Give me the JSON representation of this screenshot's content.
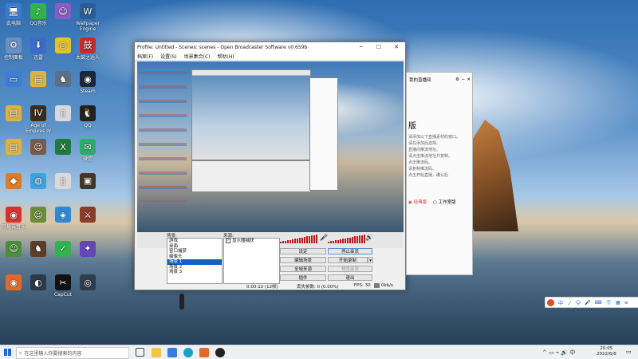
{
  "desktop": {
    "icons": [
      {
        "label": "此电脑",
        "color": "#3a7bd5",
        "glyph": "🖥"
      },
      {
        "label": "QQ音乐",
        "color": "#2fb34a",
        "glyph": "♪"
      },
      {
        "label": "",
        "color": "#8b5cc7",
        "glyph": "☺"
      },
      {
        "label": "Wallpaper Engine",
        "color": "#2a5e9a",
        "glyph": "W"
      },
      {
        "label": "控制面板",
        "color": "#6b8fc2",
        "glyph": "⚙"
      },
      {
        "label": "迅雷",
        "color": "#3a6cc9",
        "glyph": "⬇"
      },
      {
        "label": "",
        "color": "#e4c326",
        "glyph": "◎"
      },
      {
        "label": "太鼓之达人",
        "color": "#c52d2d",
        "glyph": "鼓"
      },
      {
        "label": "",
        "color": "#3b7fd6",
        "glyph": "▭"
      },
      {
        "label": "",
        "color": "#e0b23c",
        "glyph": "▤"
      },
      {
        "label": "",
        "color": "#5d6f86",
        "glyph": "♞"
      },
      {
        "label": "Steam",
        "color": "#1b2838",
        "glyph": "◉"
      },
      {
        "label": "",
        "color": "#e0b23c",
        "glyph": "▤"
      },
      {
        "label": "Age of Empires IV",
        "color": "#3b2b1a",
        "glyph": "IV"
      },
      {
        "label": "",
        "color": "#d9d9d9",
        "glyph": "▯"
      },
      {
        "label": "QQ",
        "color": "#222",
        "glyph": "🐧"
      },
      {
        "label": "",
        "color": "#e0b23c",
        "glyph": "▤"
      },
      {
        "label": "",
        "color": "#7c5a44",
        "glyph": "☺"
      },
      {
        "label": "",
        "color": "#1f7a3e",
        "glyph": "X"
      },
      {
        "label": "微信",
        "color": "#2aae67",
        "glyph": "✉"
      },
      {
        "label": "",
        "color": "#d97d2a",
        "glyph": "◆"
      },
      {
        "label": "",
        "color": "#3ca3e0",
        "glyph": "◍"
      },
      {
        "label": "",
        "color": "#d9d9d9",
        "glyph": "▯"
      },
      {
        "label": "",
        "color": "#44352a",
        "glyph": "▣"
      },
      {
        "label": "网易云音乐",
        "color": "#d8312e",
        "glyph": "◉"
      },
      {
        "label": "",
        "color": "#6c8c3a",
        "glyph": "☺"
      },
      {
        "label": "",
        "color": "#2e88d6",
        "glyph": "◈"
      },
      {
        "label": "",
        "color": "#8e3c2a",
        "glyph": "⚔"
      },
      {
        "label": "",
        "color": "#4a8f3a",
        "glyph": "☺"
      },
      {
        "label": "",
        "color": "#5b3d28",
        "glyph": "♞"
      },
      {
        "label": "",
        "color": "#2fb34a",
        "glyph": "✓"
      },
      {
        "label": "",
        "color": "#6645b5",
        "glyph": "✦"
      },
      {
        "label": "",
        "color": "#e06a2a",
        "glyph": "◉"
      },
      {
        "label": "",
        "color": "#2b3a4a",
        "glyph": "◐"
      },
      {
        "label": "CapCut",
        "color": "#111",
        "glyph": "✂"
      },
      {
        "label": "",
        "color": "#2c3e50",
        "glyph": "◎"
      }
    ]
  },
  "obs": {
    "title": "Profile: Untitled - Scenes: scenes - Open Broadcaster Software v0.659b",
    "minimize": "─",
    "maximize": "☐",
    "close": "✕",
    "menu": [
      "档案(F)",
      "设置(S)",
      "场景集合(C)",
      "帮助(H)"
    ],
    "scenes_label": "场景:",
    "sources_label": "来源:",
    "scenes": [
      "游戏",
      "桌面",
      "窗口捕获",
      "摄像头",
      "场景 1",
      "场景 2",
      "场景 3"
    ],
    "selected_scene_index": 4,
    "source_item": "显示器捕获",
    "source_checked": true,
    "buttons": {
      "settings": "设定",
      "start_stream": "停止串流",
      "edit_scene": "编辑场景",
      "start_record": "开始录制",
      "global_sources": "全域来源",
      "preview_stream": "预览串流",
      "plugins": "插件",
      "exit": "退出"
    },
    "status": {
      "time": "0:00:12 (12帧)",
      "dropped": "丢失帧数: 0 (0.00%)",
      "fps": "FPS: 30",
      "rate": "0kb/s"
    }
  },
  "assist": {
    "title": "我的直播间",
    "heading": "版",
    "lines": [
      "请添加以下直播素材的窗口。",
      "请在添加后选择。",
      "直播间推流地址。",
      "请点击推流地址并复制。",
      "点击推流码。",
      "请复制推流码。",
      "点击开始直播，确认后"
    ],
    "radio_a": "经典版",
    "radio_b": "工作室版"
  },
  "ime": {
    "items": [
      "中",
      "ノ",
      "☺",
      "🎤",
      "⌨",
      "👕",
      "▦",
      "≡"
    ]
  },
  "taskbar": {
    "search_placeholder": "在这里输入你要搜索的内容",
    "time": "20:05",
    "date": "2022/6/8"
  }
}
